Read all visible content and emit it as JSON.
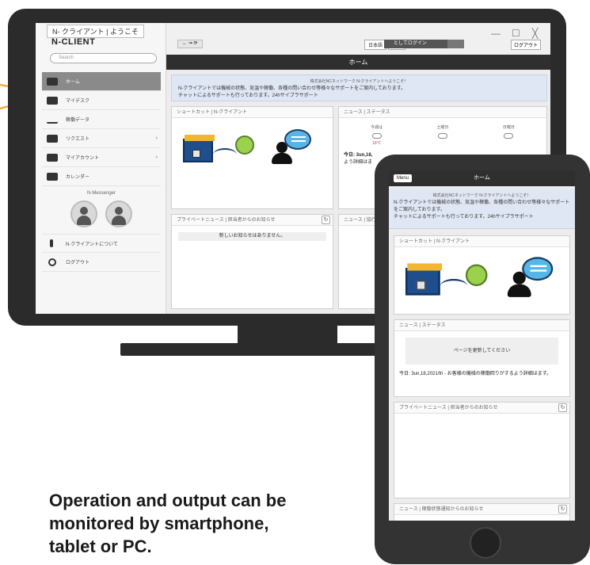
{
  "desktop": {
    "window_title": "N- クライアント | ようこそ",
    "logo": "N-CLIENT",
    "search_placeholder": "Search",
    "window_controls": {
      "minimize": "—",
      "maximize": "☐",
      "close": "╳"
    },
    "toolbar": {
      "nav_buttons": "← ⇒ ⟳",
      "lang_ja": "日本語",
      "lang_en": "英語",
      "user_name": "ユーザー名",
      "login_button": "としてログイン",
      "logout_button": "ログアウト"
    },
    "menu": [
      {
        "label": "ホーム",
        "icon": "home-icon",
        "active": true
      },
      {
        "label": "マイデスク",
        "icon": "desk-icon"
      },
      {
        "label": "稼働データ",
        "icon": "chart-line-icon"
      },
      {
        "label": "リクエスト",
        "icon": "chat-icon",
        "chevron": "›"
      },
      {
        "label": "マイアカウント",
        "icon": "user-icon",
        "chevron": "›"
      },
      {
        "label": "カレンダー",
        "icon": "calendar-icon"
      }
    ],
    "messenger_title": "N-Messenger",
    "about_link": "N-クライアントについて",
    "logout_link": "ログアウト",
    "page_title": "ホーム",
    "welcome": {
      "title": "株式会社NCネットワーク N-クライアントへようこそ！",
      "line1": "N-クライアントでは機械の状態、気温や稼働、各種の問い合わせ等様々なサポートをご案内しております。",
      "line2": "チャットによるサポートも行っております。24hサイプラサポート"
    },
    "shortcut_title": "ショートカット | N-クライアント",
    "news_title": "ニュース | ステータス",
    "weather": [
      {
        "label": "今週は",
        "temp": "18℃"
      },
      {
        "label": "土曜日",
        "temp": ""
      },
      {
        "label": "日曜日",
        "temp": ""
      }
    ],
    "today_text": "今日: 3un,18,",
    "today_text2": "よう詳細はま",
    "private_news_title": "プライベートニュース | 担当者からのお知らせ",
    "no_news": "新しいお知らせはありません。",
    "other_panel_title": "ニュース | 協行"
  },
  "tablet": {
    "menu_label": "Menu",
    "page_title": "ホーム",
    "welcome": {
      "title": "株式会社NCネットワーク N-クライアントへようこそ！",
      "line1": "N-クライアントでは機械の状態、気温や稼働、各種の問い合わせ等様々なサポートをご案内しております。",
      "line2": "チャットによるサポートも行っております。24hサイプラサポート"
    },
    "shortcut_title": "ショートカット | N-クライアント",
    "news_title": "ニュース | ステータス",
    "notice": "ページを更新してください",
    "today_text": "今日: 3un,18,2021/fri - お客様の機械の稼働回りがするよう詳細はます。",
    "private_news_title": "プライベートニュース | 担当者からのお知らせ",
    "bottom_title": "ニュース | 稼働状態通知からのお知らせ"
  },
  "caption": {
    "line1": "Operation and output can be",
    "line2": "monitored by smartphone,",
    "line3": "tablet or PC."
  },
  "colors": {
    "frame": "#2b2b2b",
    "header": "#2f2f2f",
    "welcome_bg": "#dfe7f4",
    "pointer": "#f39a1e"
  }
}
